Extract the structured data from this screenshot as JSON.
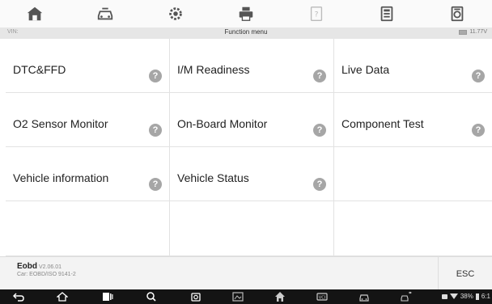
{
  "toolbar": {
    "buttons": [
      {
        "icon": "home-icon"
      },
      {
        "icon": "vehicle-swap-icon"
      },
      {
        "icon": "settings-gear-icon"
      },
      {
        "icon": "print-icon"
      },
      {
        "icon": "help-icon"
      },
      {
        "icon": "save-icon"
      },
      {
        "icon": "data-logging-icon"
      }
    ]
  },
  "titlebar": {
    "vin": "VIN:",
    "title": "Function menu",
    "battery": "11.77V"
  },
  "menu": {
    "items": [
      {
        "label": "DTC&FFD",
        "help": "?"
      },
      {
        "label": "I/M Readiness",
        "help": "?"
      },
      {
        "label": "Live Data",
        "help": "?"
      },
      {
        "label": "O2 Sensor Monitor",
        "help": "?"
      },
      {
        "label": "On-Board Monitor",
        "help": "?"
      },
      {
        "label": "Component Test",
        "help": "?"
      },
      {
        "label": "Vehicle information",
        "help": "?"
      },
      {
        "label": "Vehicle Status",
        "help": "?"
      },
      {
        "label": "",
        "help": ""
      },
      {
        "label": "",
        "help": ""
      },
      {
        "label": "",
        "help": ""
      },
      {
        "label": "",
        "help": ""
      }
    ]
  },
  "footer": {
    "title": "Eobd",
    "version": "V2.06.01",
    "car": "Car: EOBD/ISO 9141-2",
    "esc": "ESC"
  },
  "navbar": {
    "icons": [
      "back-icon",
      "home-icon",
      "recent-apps-icon",
      "search-icon",
      "camera-icon",
      "screenshot-icon",
      "maxisys-home-icon",
      "vci-icon",
      "car-icon",
      "car-swap-icon"
    ],
    "status": "38%",
    "time": "6:1"
  }
}
